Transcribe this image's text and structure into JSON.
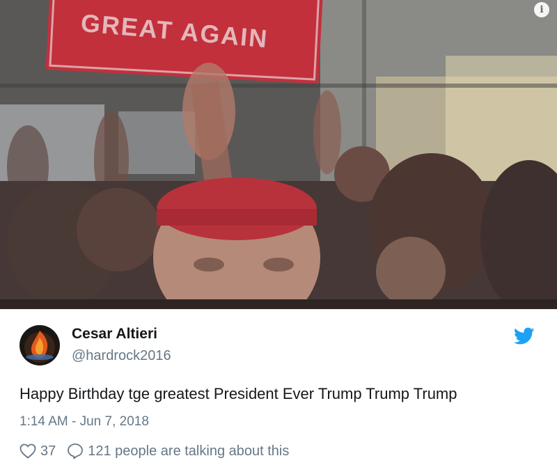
{
  "media": {
    "sign_text": "GREAT AGAIN",
    "sign_color": "#c2303c",
    "info_glyph": "i"
  },
  "tweet": {
    "author_name": "Cesar Altieri",
    "handle": "@hardrock2016",
    "text": "Happy Birthday tge greatest President Ever Trump Trump Trump",
    "timestamp": "1:14 AM - Jun 7, 2018",
    "like_count": "37",
    "conversation_text": "121 people are talking about this"
  },
  "icons": {
    "brand": "twitter-bird-icon",
    "like": "heart-icon",
    "reply": "speech-bubble-icon",
    "info": "info-icon"
  },
  "colors": {
    "twitter_blue": "#1da1f2",
    "secondary_text": "#657786",
    "primary_text": "#14171a"
  }
}
